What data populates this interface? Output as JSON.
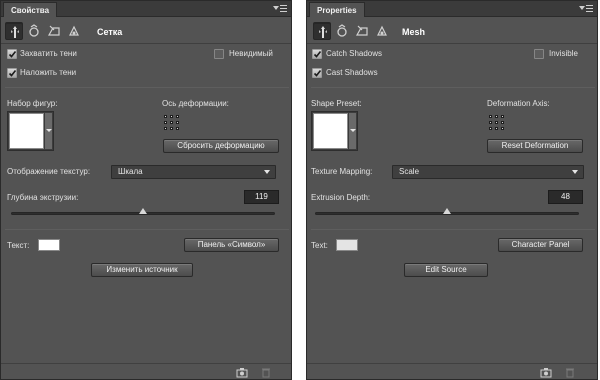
{
  "panels": [
    {
      "lang": "ru",
      "tab_label": "Свойства",
      "mode_title": "Сетка",
      "catch_shadows": "Захватить тени",
      "cast_shadows": "Наложить тени",
      "invisible": "Невидимый",
      "shape_preset": "Набор фигур:",
      "deformation_axis": "Ось деформации:",
      "reset_deformation": "Сбросить деформацию",
      "texture_mapping": "Отображение текстур:",
      "texture_mapping_value": "Шкала",
      "extrusion_depth": "Глубина экструзии:",
      "extrusion_depth_value": "119",
      "extrusion_depth_level": 0.5,
      "text_label": "Текст:",
      "character_panel": "Панель «Символ»",
      "edit_source": "Изменить источник",
      "text_color": "#ffffff",
      "catch_shadows_checked": true,
      "cast_shadows_checked": true,
      "invisible_checked": false
    },
    {
      "lang": "en",
      "tab_label": "Properties",
      "mode_title": "Mesh",
      "catch_shadows": "Catch Shadows",
      "cast_shadows": "Cast Shadows",
      "invisible": "Invisible",
      "shape_preset": "Shape Preset:",
      "deformation_axis": "Deformation Axis:",
      "reset_deformation": "Reset Deformation",
      "texture_mapping": "Texture Mapping:",
      "texture_mapping_value": "Scale",
      "extrusion_depth": "Extrusion Depth:",
      "extrusion_depth_value": "48",
      "extrusion_depth_level": 0.5,
      "text_label": "Text:",
      "character_panel": "Character Panel",
      "edit_source": "Edit Source",
      "text_color": "#e4e4e4",
      "catch_shadows_checked": true,
      "cast_shadows_checked": true,
      "invisible_checked": false
    }
  ],
  "icons": {
    "mode_icons": [
      "mesh-filter-icon",
      "deform-icon",
      "cap-icon",
      "coordinates-icon"
    ],
    "panel_menu": "panel-menu-icon",
    "footer_icons": [
      "render-icon",
      "trash-icon"
    ]
  },
  "colors": {
    "panel_bg": "#535353",
    "titlebar_bg": "#3b3b3b",
    "text": "#e2e2e2"
  }
}
